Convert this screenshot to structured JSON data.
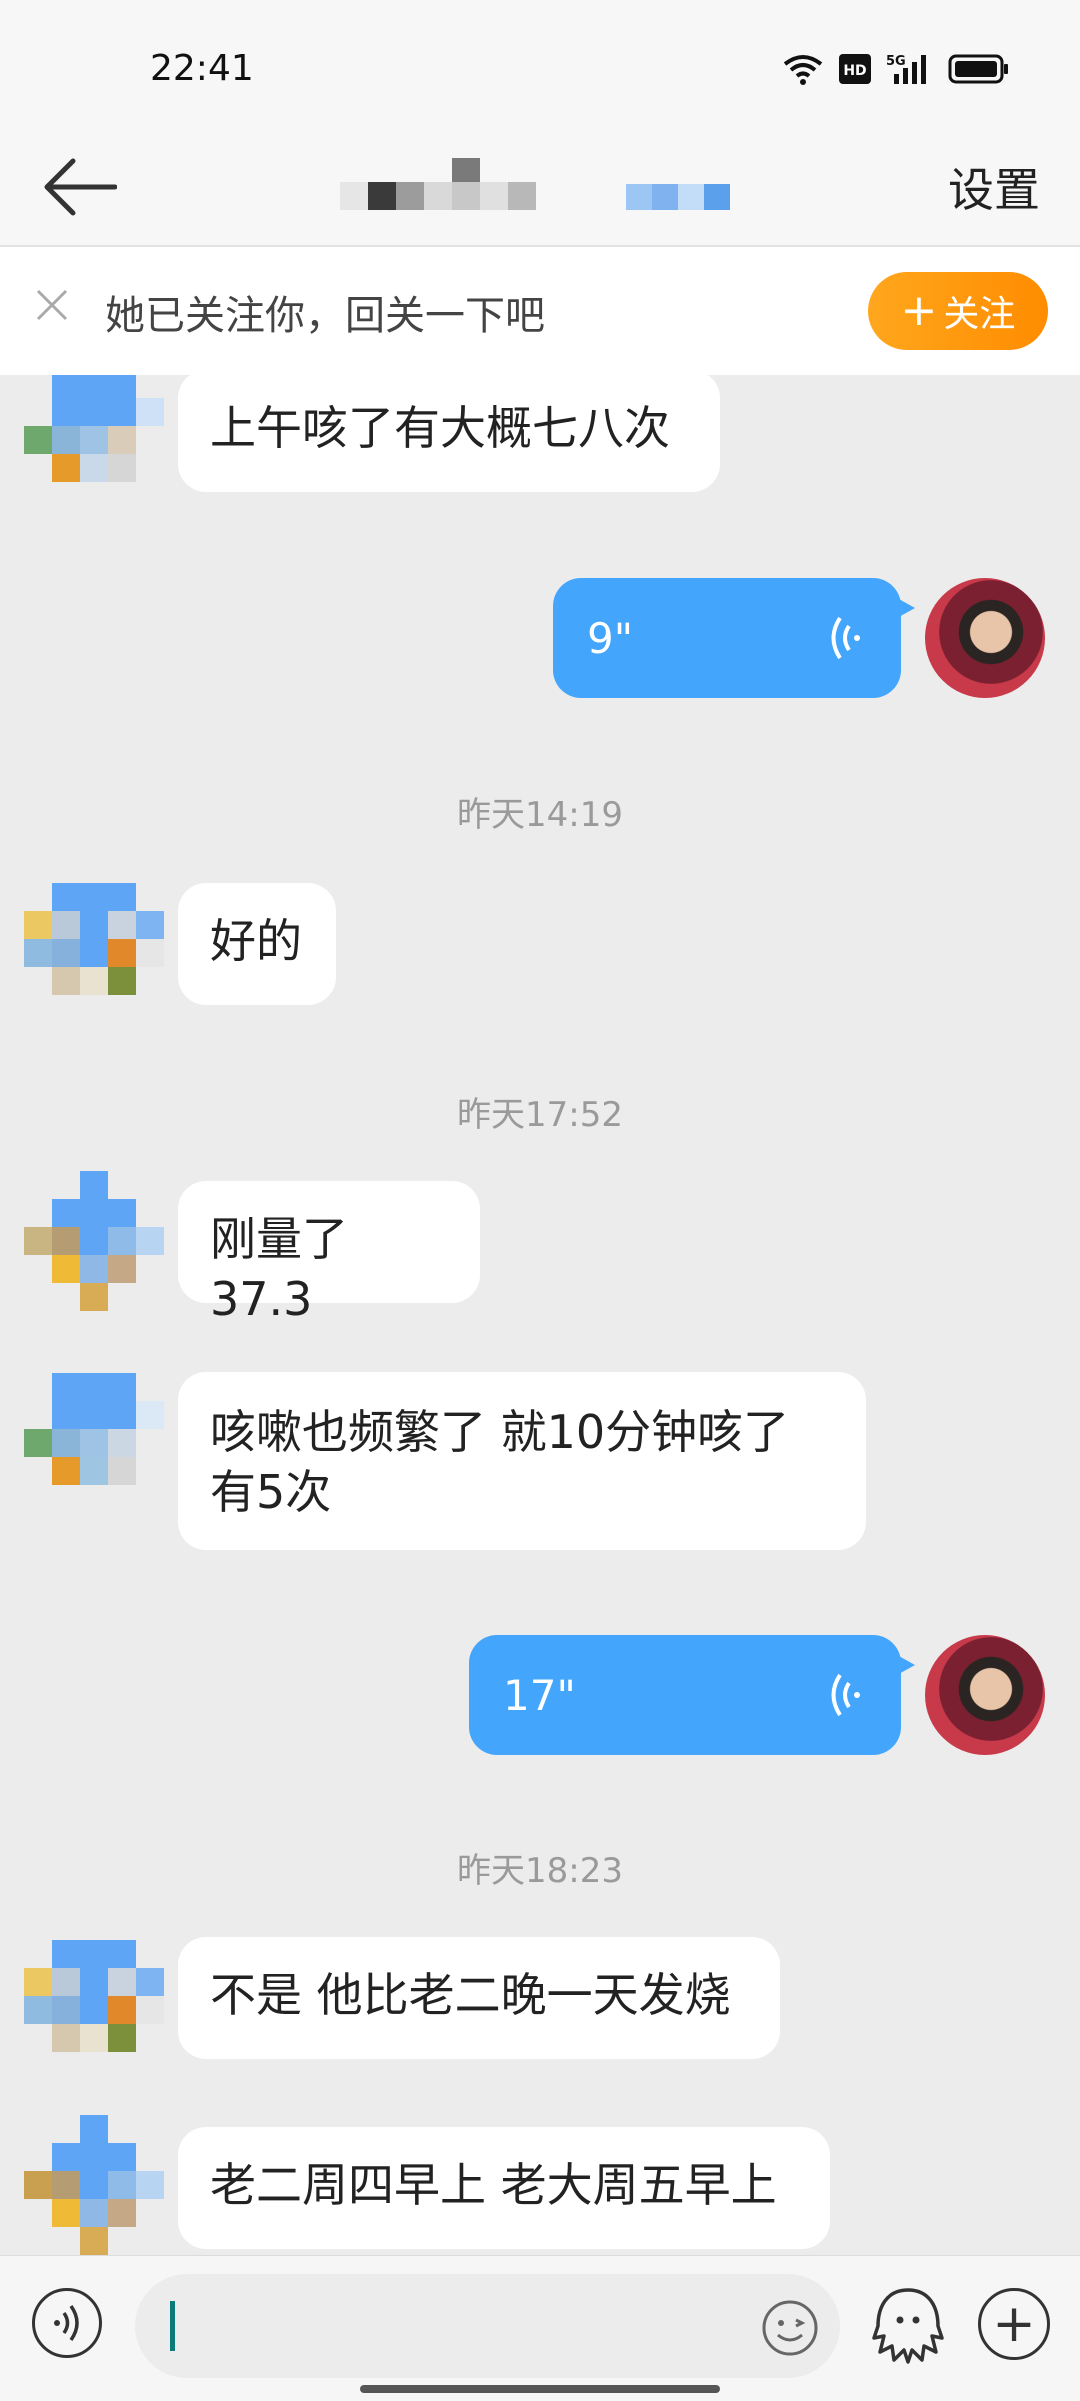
{
  "status_bar": {
    "time": "22:41",
    "icons": [
      "wifi-icon",
      "hd-icon",
      "5g-signal-icon",
      "battery-icon"
    ]
  },
  "header": {
    "back_icon": "arrow-left-icon",
    "settings_label": "设置"
  },
  "follow_banner": {
    "text": "她已关注你，回关一下吧",
    "button_label": "关注"
  },
  "messages": [
    {
      "side": "in",
      "text": "上午咳了有大概七八次"
    },
    {
      "side": "out",
      "duration": "9\""
    },
    {
      "type": "time",
      "text": "昨天14:19"
    },
    {
      "side": "in",
      "text": "好的"
    },
    {
      "type": "time",
      "text": "昨天17:52"
    },
    {
      "side": "in",
      "text": "刚量了37.3"
    },
    {
      "side": "in",
      "text": "咳嗽也频繁了 就10分钟咳了有5次"
    },
    {
      "side": "out",
      "duration": "17\""
    },
    {
      "type": "time",
      "text": "昨天18:23"
    },
    {
      "side": "in",
      "text": "不是 他比老二晚一天发烧"
    },
    {
      "side": "in",
      "text": "老二周四早上 老大周五早上"
    }
  ],
  "input": {
    "placeholder": ""
  },
  "colors": {
    "accent_blue": "#43a5fb",
    "follow_orange": "#ff9a0f",
    "bg": "#ececec"
  }
}
